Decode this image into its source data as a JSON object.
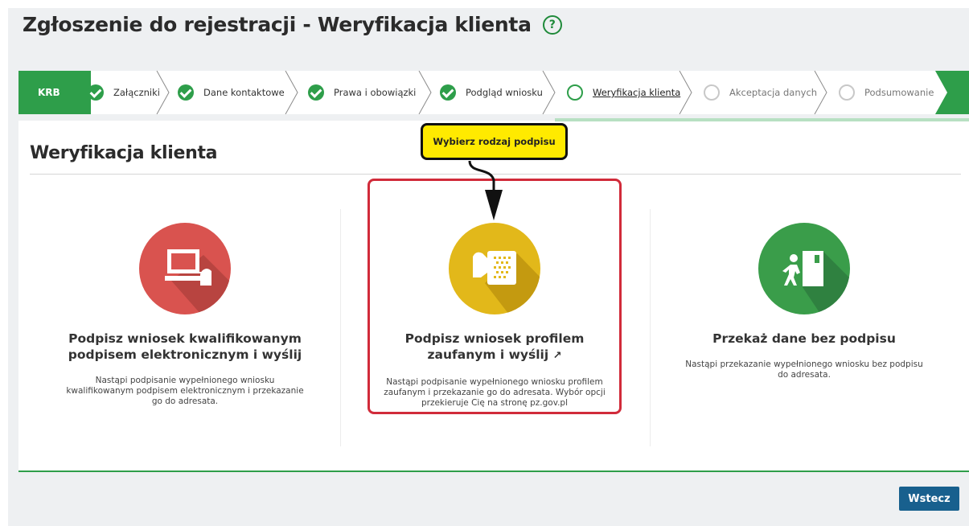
{
  "header": {
    "title": "Zgłoszenie do rejestracji - Weryfikacja klienta",
    "help_icon": "?"
  },
  "wizard": {
    "krb": "KRB",
    "steps": [
      {
        "label": "Załączniki",
        "state": "done"
      },
      {
        "label": "Dane kontaktowe",
        "state": "done"
      },
      {
        "label": "Prawa i obowiązki",
        "state": "done"
      },
      {
        "label": "Podgląd wniosku",
        "state": "done"
      },
      {
        "label": "Weryfikacja klienta",
        "state": "current"
      },
      {
        "label": "Akceptacja danych",
        "state": "todo"
      },
      {
        "label": "Podsumowanie",
        "state": "todo"
      }
    ]
  },
  "section": {
    "title": "Weryfikacja klienta"
  },
  "tooltip": {
    "text": "Wybierz rodzaj podpisu"
  },
  "options": [
    {
      "icon": "computer-signature-icon",
      "color": "#d9534f",
      "title": "Podpisz wniosek kwalifikowanym podpisem elektronicznym i wyślij",
      "description": "Nastąpi podpisanie wypełnionego wniosku kwalifikowanym podpisem elektronicznym i przekazanie go do adresata."
    },
    {
      "icon": "trusted-profile-icon",
      "color": "#e2b81a",
      "title": "Podpisz wniosek profilem zaufanym i wyślij",
      "external_icon": "external-link-icon",
      "description": "Nastąpi podpisanie wypełnionego wniosku profilem zaufanym i przekazanie go do adresata. Wybór opcji przekieruje Cię na stronę pz.gov.pl"
    },
    {
      "icon": "person-door-icon",
      "color": "#3a9d4a",
      "title": "Przekaż dane bez podpisu",
      "description": "Nastąpi przekazanie wypełnionego wniosku bez podpisu do adresata."
    }
  ],
  "footer": {
    "back_label": "Wstecz"
  },
  "colors": {
    "accent_green": "#2e9e4a",
    "button_blue": "#18608e",
    "highlight_red": "#d12b3a",
    "tooltip_yellow": "#ffea00"
  }
}
